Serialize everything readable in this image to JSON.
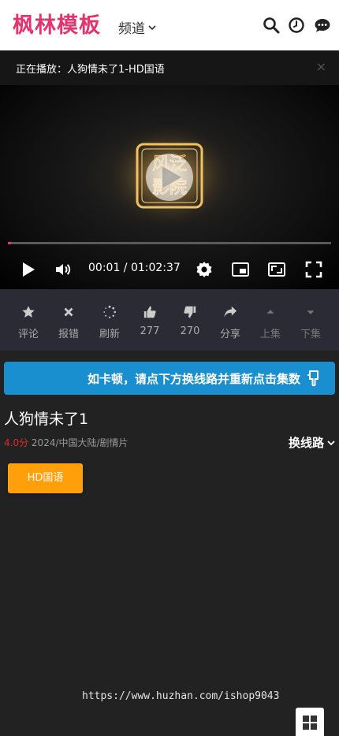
{
  "header": {
    "logo": "枫林模板",
    "channel_label": "频道",
    "icons": [
      "search-icon",
      "history-clock-icon",
      "message-icon"
    ]
  },
  "now_playing": {
    "text": "正在播放：人狗情未了1-HD国语",
    "close": "×"
  },
  "player": {
    "current_time": "00:01",
    "duration": "01:02:37",
    "time_display": "00:01 / 01:02:37",
    "progress": 0.01,
    "overlay_logo": "风泛影院",
    "accent_color": "#e5336e"
  },
  "actions": [
    {
      "label": "评论",
      "icon": "star-icon"
    },
    {
      "label": "报错",
      "icon": "x-mark-icon"
    },
    {
      "label": "刷新",
      "icon": "refresh-spinner-icon"
    },
    {
      "label": "277",
      "icon": "thumbs-up-icon"
    },
    {
      "label": "270",
      "icon": "thumbs-down-icon"
    },
    {
      "label": "分享",
      "icon": "share-icon"
    },
    {
      "label": "上集",
      "icon": "caret-up-icon"
    },
    {
      "label": "下集",
      "icon": "caret-down-icon"
    }
  ],
  "tip": {
    "text": "如卡顿，请点下方换线路并重新点击集数",
    "color": "#1a8fd0"
  },
  "movie": {
    "title": "人狗情未了1",
    "score": "4.0分",
    "info": "2024/中国大陆/剧情片",
    "switch_line": "换线路"
  },
  "episodes": [
    "HD国语"
  ],
  "watermark": "https://www.huzhan.com/ishop9043"
}
